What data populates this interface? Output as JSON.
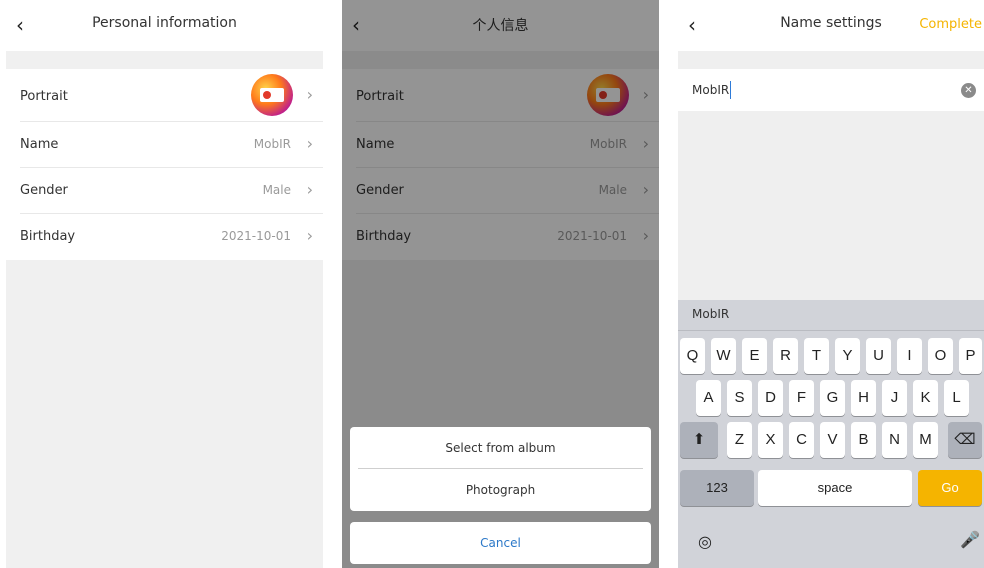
{
  "screen1": {
    "title": "Personal information",
    "back_icon": "chevron-left-icon",
    "rows": [
      {
        "label": "Portrait",
        "value": ""
      },
      {
        "label": "Name",
        "value": "MobIR"
      },
      {
        "label": "Gender",
        "value": "Male"
      },
      {
        "label": "Birthday",
        "value": "2021-10-01"
      }
    ]
  },
  "screen2": {
    "title": "个人信息",
    "rows": [
      {
        "label": "Portrait",
        "value": ""
      },
      {
        "label": "Name",
        "value": "MobIR"
      },
      {
        "label": "Gender",
        "value": "Male"
      },
      {
        "label": "Birthday",
        "value": "2021-10-01"
      }
    ],
    "sheet": {
      "option1": "Select from album",
      "option2": "Photograph",
      "cancel": "Cancel"
    }
  },
  "screen3": {
    "title": "Name settings",
    "complete": "Complete",
    "input_value": "MobIR",
    "suggestion": "MobIR",
    "keys": {
      "row1": [
        "Q",
        "W",
        "E",
        "R",
        "T",
        "Y",
        "U",
        "I",
        "O",
        "P"
      ],
      "row2": [
        "A",
        "S",
        "D",
        "F",
        "G",
        "H",
        "J",
        "K",
        "L"
      ],
      "row3": [
        "Z",
        "X",
        "C",
        "V",
        "B",
        "N",
        "M"
      ],
      "num": "123",
      "space": "space",
      "go": "Go"
    }
  },
  "colors": {
    "accent": "#f5b400",
    "link": "#2b78c8",
    "overlay": "rgba(0,0,0,0.42)"
  }
}
